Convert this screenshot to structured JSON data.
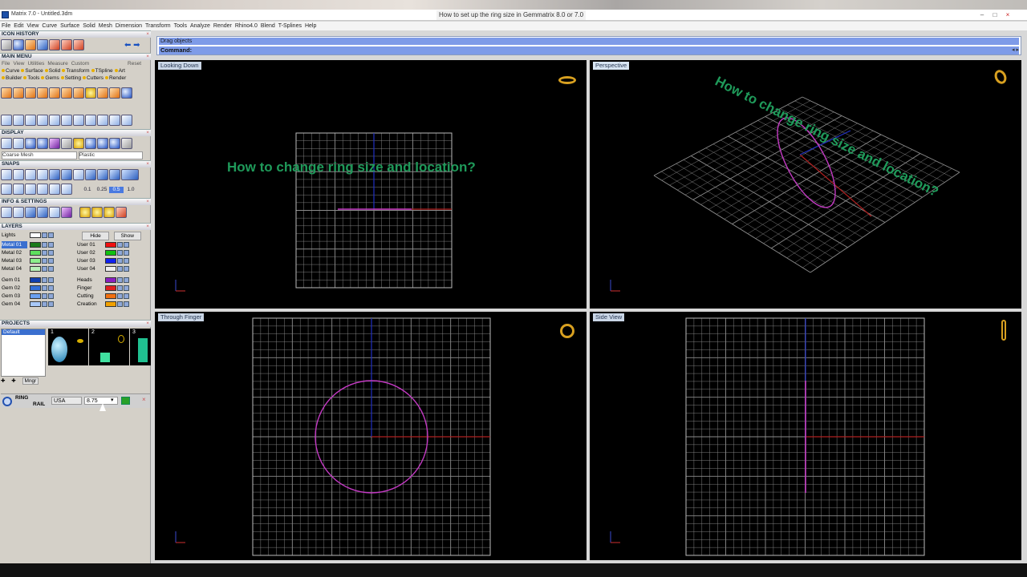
{
  "window": {
    "title": "Matrix 7.0 - Untitled.3dm",
    "overlay_title": "How to set up the ring size in Gemmatrix 8.0 or 7.0"
  },
  "menu": [
    "File",
    "Edit",
    "View",
    "Curve",
    "Surface",
    "Solid",
    "Mesh",
    "Dimension",
    "Transform",
    "Tools",
    "Analyze",
    "Render",
    "Rhino4.0",
    "Blend",
    "T-Splines",
    "Help"
  ],
  "command": {
    "hint": "Drag objects",
    "label": "Command:"
  },
  "left": {
    "icon_history": "ICON HISTORY",
    "main_menu": "MAIN MENU",
    "main_menu_tabs": [
      "File",
      "View",
      "Utilities",
      "Measure",
      "Custom"
    ],
    "main_menu_reset": "Reset",
    "main_menu_items_row1": [
      "Curve",
      "Surface",
      "Solid",
      "Transform",
      "TSpline",
      "Art"
    ],
    "main_menu_items_row2": [
      "Builder",
      "Tools",
      "Gems",
      "Setting",
      "Cutters",
      "Render"
    ],
    "display": "DISPLAY",
    "display_mesh": "Coarse Mesh",
    "display_material": "Plastic",
    "snaps": "SNAPS",
    "snap_values": [
      "0.1",
      "0.25",
      "0.5",
      "1.0"
    ],
    "info_settings": "INFO & SETTINGS",
    "layers_title": "LAYERS",
    "lights_label": "Lights",
    "hide_label": "Hide",
    "show_label": "Show",
    "layers_left": [
      {
        "name": "Metal 01",
        "color": "#1a7a1a"
      },
      {
        "name": "Metal 02",
        "color": "#5ee05e"
      },
      {
        "name": "Metal 03",
        "color": "#8cf08c"
      },
      {
        "name": "Metal 04",
        "color": "#b8f0b8"
      },
      {
        "name": "Gem 01",
        "color": "#1040b0"
      },
      {
        "name": "Gem 02",
        "color": "#3470d8"
      },
      {
        "name": "Gem 03",
        "color": "#6aa0f0"
      },
      {
        "name": "Gem 04",
        "color": "#a8c8f8"
      }
    ],
    "layers_right": [
      {
        "name": "User 01",
        "color": "#f01010"
      },
      {
        "name": "User 02",
        "color": "#10c010"
      },
      {
        "name": "User 03",
        "color": "#1020f0"
      },
      {
        "name": "User 04",
        "color": "#f0f0f0"
      },
      {
        "name": "Heads",
        "color": "#8a20c0"
      },
      {
        "name": "Finger",
        "color": "#e02020"
      },
      {
        "name": "Cutting",
        "color": "#f07010"
      },
      {
        "name": "Creation",
        "color": "#f0a000"
      }
    ],
    "projects_title": "PROJECTS",
    "project_default": "Default",
    "project_numbers": [
      "1",
      "2",
      "3"
    ],
    "project_manager": "Mngr",
    "ring_label_1": "RING",
    "ring_label_2": "RAIL",
    "ring_country": "USA",
    "ring_size": "8.75"
  },
  "viewports": {
    "top_left": {
      "label": "Looking Down",
      "overlay_text": "How to change ring size and location?"
    },
    "top_right": {
      "label": "Perspective",
      "overlay_text": "How to change ring size and location?"
    },
    "bottom_left": {
      "label": "Through Finger"
    },
    "bottom_right": {
      "label": "Side View"
    }
  },
  "colors": {
    "viewport_bg": "#000000",
    "grid": "#8c8c8c",
    "ring_curve": "#c23ac2",
    "x_axis": "#b02020",
    "y_axis": "#2030c0",
    "overlay_green": "#1f9a5a"
  }
}
